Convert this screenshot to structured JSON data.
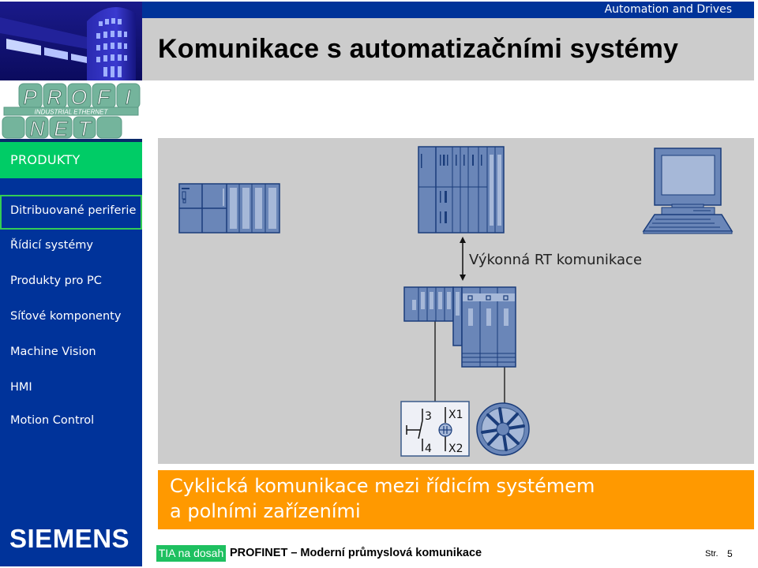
{
  "header": {
    "brand_bar": "Automation and Drives",
    "title": "Komunikace s automatizačními systémy"
  },
  "logo": {
    "top_row": [
      "P",
      "R",
      "O",
      "F",
      "I"
    ],
    "tagline": "INDUSTRIAL ETHERNET",
    "bottom_row": [
      "N",
      "E",
      "T"
    ]
  },
  "sidebar": {
    "section": "PRODUKTY",
    "items": [
      {
        "label": "Ditribuované periferie",
        "selected": true
      },
      {
        "label": "Řídicí systémy",
        "selected": false
      },
      {
        "label": "Produkty pro PC",
        "selected": false
      },
      {
        "label": "Síťové komponenty",
        "selected": false
      },
      {
        "label": "Machine Vision",
        "selected": false
      },
      {
        "label": "HMI",
        "selected": false
      },
      {
        "label": "Motion Control",
        "selected": false
      }
    ],
    "company": "SIEMENS"
  },
  "diagram": {
    "link_label": "Výkonná RT komunikace",
    "switch": {
      "contact_top": "3",
      "contact_bottom": "4",
      "terminal_top": "X1",
      "terminal_bottom": "X2"
    },
    "devices": [
      "compact-plc",
      "rack-plc",
      "pc-workstation",
      "distributed-io",
      "drive",
      "pushbutton-switch",
      "motor"
    ]
  },
  "caption": {
    "line1": "Cyklická komunikace mezi řídicím systémem",
    "line2": "a polními zařízeními"
  },
  "footer": {
    "badge": "TIA na dosah",
    "title": "PROFINET – Moderní průmyslová komunikace",
    "page_label": "Str.",
    "page_number": "5"
  },
  "colors": {
    "brand_blue": "#003399",
    "sidebar_blue": "#00339a",
    "accent_green": "#00cc66",
    "caption_orange": "#ff9900",
    "panel_gray": "#cccccc",
    "device_blue": "#6a86b8",
    "device_outline": "#1a3c7a"
  }
}
